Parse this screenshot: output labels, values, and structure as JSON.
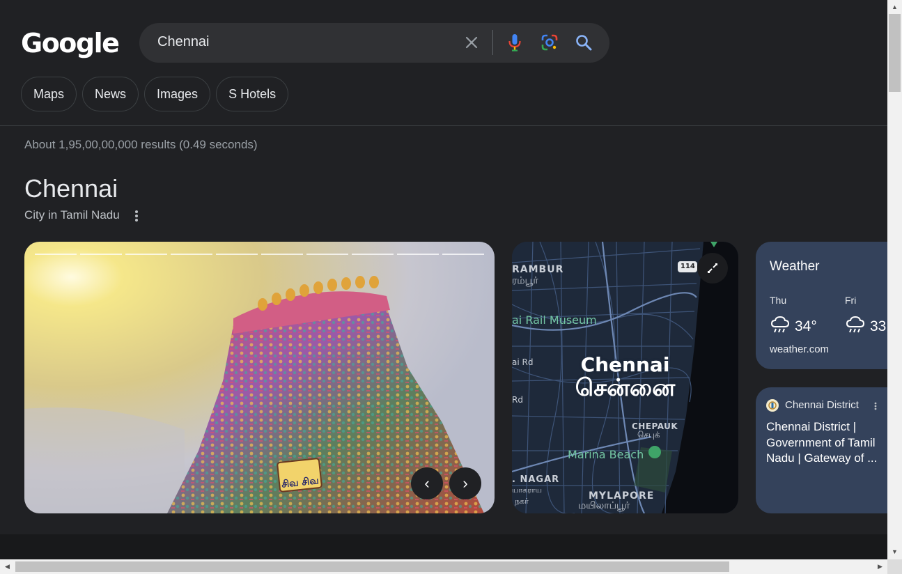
{
  "logo": "Google",
  "search": {
    "query": "Chennai"
  },
  "chips": [
    "Maps",
    "News",
    "Images",
    "S Hotels"
  ],
  "stats": "About 1,95,00,00,000 results (0.49 seconds)",
  "knowledge_panel": {
    "title": "Chennai",
    "subtitle": "City in Tamil Nadu"
  },
  "carousel": {
    "image": "Gopuram temple tower",
    "signboard": "சிவ சிவ",
    "prev_icon": "‹",
    "next_icon": "›"
  },
  "map": {
    "labels": {
      "perambur": "RAMBUR",
      "perambur_ta": "ரம்பூர்",
      "rail_museum": "ai Rail Museum",
      "rd1": "ai Rd",
      "rd2": "Rd",
      "city": "Chennai",
      "city_ta": "சென்னை",
      "chepauk": "CHEPAUK",
      "chepauk_ta": "செபுக்",
      "marina": "Marina Beach",
      "nagar": ". NAGAR",
      "nagar_ta": "யாகராய",
      "nagar_ta2": "நகர்",
      "mylapore": "MYLAPORE",
      "mylapore_ta": "மயிலாப்பூர்",
      "highway": "114"
    }
  },
  "weather": {
    "title": "Weather",
    "days": [
      {
        "day": "Thu",
        "temp": "34°",
        "icon": "rain-cloud-icon"
      },
      {
        "day": "Fri",
        "temp": "33",
        "icon": "rain-cloud-icon"
      }
    ],
    "source": "weather.com"
  },
  "district": {
    "name": "Chennai District",
    "text": "Chennai District | Government of Tamil Nadu | Gateway of ..."
  },
  "colors": {
    "background": "#202124",
    "card": "#34425b",
    "chip_border": "#3c4043",
    "text_secondary": "#9aa0a6"
  }
}
